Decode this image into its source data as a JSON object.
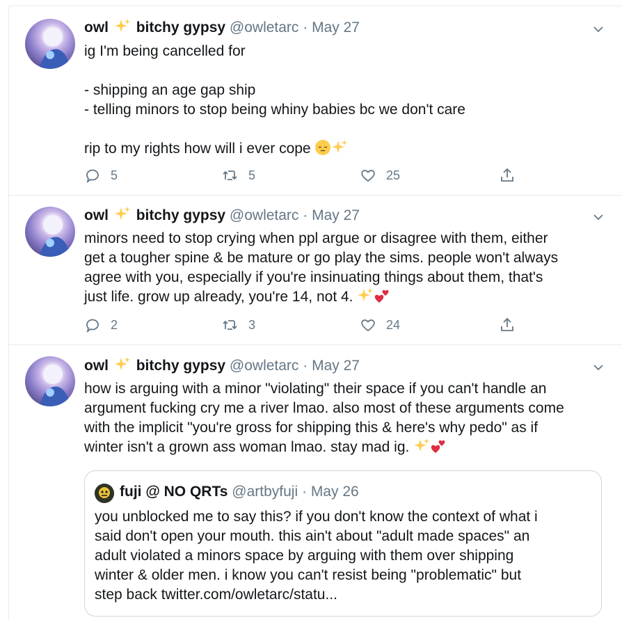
{
  "colors": {
    "text": "#14171a",
    "secondary": "#657786",
    "border": "#e6ecf0",
    "quote_border": "#ccd6dd",
    "sparkle": "#ffcc4d",
    "heart": "#dd2e44"
  },
  "tweets": [
    {
      "name_first": "owl",
      "name_second": "bitchy gypsy",
      "handle": "@owletarc",
      "dot": "·",
      "date": "May 27",
      "text": "ig I'm being cancelled for\n\n- shipping an age gap ship\n- telling minors to stop being whiny babies bc we don't care\n\nrip to my rights how will i ever cope",
      "trailing_emoji": [
        "pensive-face",
        "sparkles"
      ],
      "replies": "5",
      "retweets": "5",
      "likes": "25"
    },
    {
      "name_first": "owl",
      "name_second": "bitchy gypsy",
      "handle": "@owletarc",
      "dot": "·",
      "date": "May 27",
      "text": "minors need to stop crying when ppl argue or disagree with them, either\nget a tougher spine & be mature or go play the sims. people won't always\nagree with you, especially if you're insinuating things about them, that's\njust life. grow up already, you're 14, not 4.",
      "trailing_emoji": [
        "sparkles",
        "two-hearts"
      ],
      "replies": "2",
      "retweets": "3",
      "likes": "24"
    },
    {
      "name_first": "owl",
      "name_second": "bitchy gypsy",
      "handle": "@owletarc",
      "dot": "·",
      "date": "May 27",
      "text": "how is arguing with a minor \"violating\" their space if you can't handle an\nargument fucking cry me a river lmao. also most of these arguments come\nwith the implicit \"you're gross for shipping this & here's why pedo\" as if\nwinter isn't a grown ass woman lmao. stay mad ig.",
      "trailing_emoji": [
        "sparkles",
        "two-hearts"
      ],
      "quote": {
        "name": "fuji @ NO QRTs",
        "handle": "@artbyfuji",
        "dot": "·",
        "date": "May 26",
        "text": "you unblocked me to say this? if you don't know the context of what i\nsaid don't open your mouth. this ain't about \"adult made spaces\" an\nadult violated a minors space by arguing with them over shipping\nwinter & older men. i know you can't resist being \"problematic\" but\nstep back twitter.com/owletarc/statu..."
      }
    }
  ],
  "icons": {
    "reply": "reply-bubble-icon",
    "retweet": "retweet-icon",
    "like": "heart-outline-icon",
    "share": "share-upload-icon",
    "more": "chevron-down-icon"
  }
}
